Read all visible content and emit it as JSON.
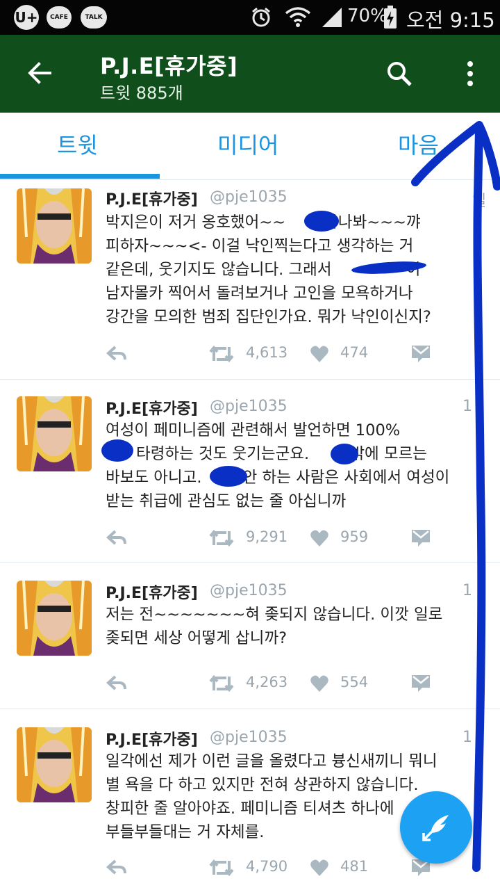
{
  "status_bar": {
    "app_icons": [
      "U+",
      "CAFE",
      "TALK"
    ],
    "battery": "70%",
    "time": "오전 9:15"
  },
  "header": {
    "title": "P.J.E[휴가중]",
    "subtitle": "트윗 885개",
    "color": "#104f1c"
  },
  "tabs": [
    {
      "label": "트윗"
    },
    {
      "label": "미디어"
    },
    {
      "label": "마음"
    }
  ],
  "accent": "#1b95e0",
  "tweets": [
    {
      "name": "P.J.E[휴가중]",
      "handle": "@pje1035",
      "time": "일",
      "lines": [
        "박지은이 저거 옹호했어~~ ",
        "하나봐~~~꺄",
        "피하자~~~<- 이걸 낙인찍는다고 생각하는 거",
        "같은데, 웃기지도 않습니다. 그래서 ",
        "이",
        "남자몰카 찍어서 돌려보거나 고인을 모욕하거나",
        "강간을 모의한 범죄 집단인가요. 뭐가 낙인이신지?"
      ],
      "retweets": "4,613",
      "likes": "474"
    },
    {
      "name": "P.J.E[휴가중]",
      "handle": "@pje1035",
      "time": "1",
      "lines": [
        "여성이 페미니즘에 관련해서 발언하면 100%",
        "타령하는 것도 웃기는군요. ",
        "밖에 모르는",
        "바보도 아니고. ",
        "안 하는 사람은 사회에서 여성이",
        "받는 취급에 관심도 없는 줄 아십니까"
      ],
      "retweets": "9,291",
      "likes": "959"
    },
    {
      "name": "P.J.E[휴가중]",
      "handle": "@pje1035",
      "time": "1",
      "lines": [
        "저는 전~~~~~~~혀 좆되지 않습니다. 이깟 일로",
        "좆되면 세상 어떻게 삽니까?"
      ],
      "retweets": "4,263",
      "likes": "554"
    },
    {
      "name": "P.J.E[휴가중]",
      "handle": "@pje1035",
      "time": "1",
      "lines": [
        "일각에선 제가 이런 글을 올렸다고 븅신새끼니 뭐니",
        "별 욕을 다 하고 있지만 전혀 상관하지 않습니다.",
        "창피한 줄 알아야죠. 페미니즘 티셔츠 하나에",
        "부들부들대는 거 자체를."
      ],
      "retweets": "4,790",
      "likes": "481"
    }
  ],
  "icons": {
    "back": "arrow-left-icon",
    "search": "search-icon",
    "more": "more-vert-icon",
    "reply": "reply-icon",
    "retweet": "retweet-icon",
    "like": "heart-icon",
    "dm": "envelope-icon",
    "compose": "compose-tweet-icon"
  },
  "annotation_color": "#0a2fc4"
}
